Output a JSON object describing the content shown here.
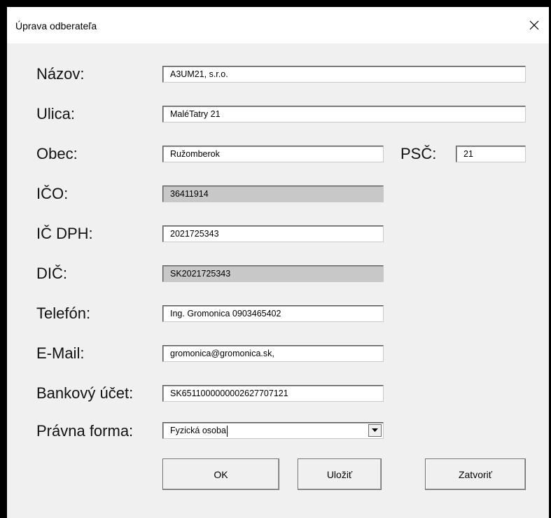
{
  "dialog": {
    "title": "Úprava odberateľa",
    "close_icon": "close-icon"
  },
  "form": {
    "nazov": {
      "label": "Názov:",
      "value": "A3UM21, s.r.o."
    },
    "ulica": {
      "label": "Ulica:",
      "value": "MaléTatry 21"
    },
    "obec": {
      "label": "Obec:",
      "value": "Ružomberok"
    },
    "psc": {
      "label": "PSČ:",
      "value": "21"
    },
    "ico": {
      "label": "IČO:",
      "value": "36411914",
      "disabled": true
    },
    "ic_dph": {
      "label": "IČ DPH:",
      "value": "2021725343"
    },
    "dic": {
      "label": "DIČ:",
      "value": "SK2021725343",
      "disabled": true
    },
    "telefon": {
      "label": "Telefón:",
      "value": "Ing. Gromonica 0903465402"
    },
    "email": {
      "label": "E-Mail:",
      "value": "gromonica@gromonica.sk,"
    },
    "bankovy_ucet": {
      "label": "Bankový účet:",
      "value": "SK6511000000002627707121"
    },
    "pravna_forma": {
      "label": "Právna forma:",
      "value": "Fyzická osoba",
      "dropdown_icon": "chevron-down-icon"
    }
  },
  "buttons": {
    "ok": "OK",
    "ulozit": "Uložiť",
    "zatvorit": "Zatvoriť"
  },
  "colors": {
    "client_background": "#f0f0f0",
    "disabled_field": "#c8c8c8",
    "frame": "#000000"
  }
}
